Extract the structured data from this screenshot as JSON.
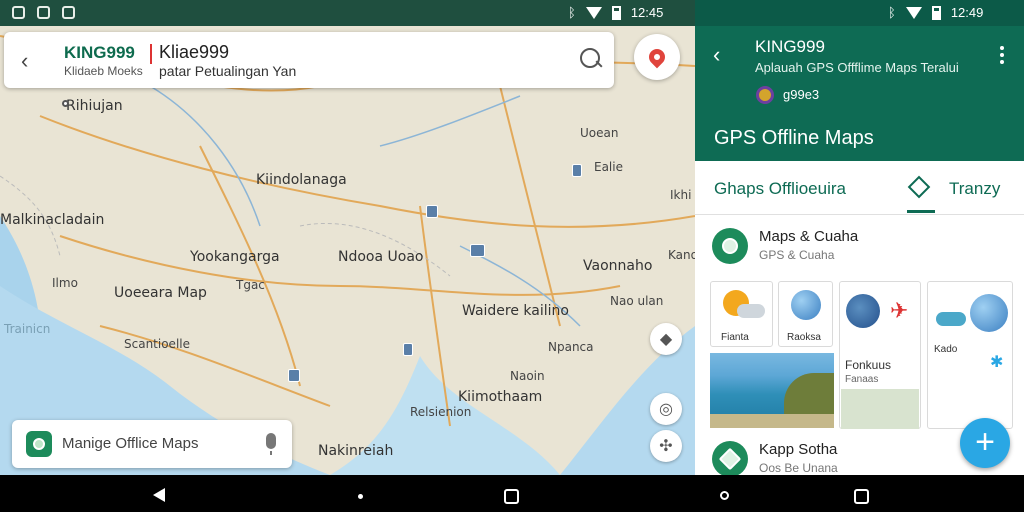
{
  "status_left": {
    "time": "12:45"
  },
  "status_right": {
    "time": "12:49"
  },
  "map": {
    "search_card": {
      "brand": "KING999",
      "brand_sub": "Kliae999",
      "tagline_left": "Klidaeb Moeks",
      "tagline_right": "patar Petualingan Yan"
    },
    "labels": {
      "rihiujan": "Rihiujan",
      "uoean": "Uoean",
      "ealie": "Ealie",
      "kiindolanaga": "Kiindolanaga",
      "malkinacladain": "Malkinacladain",
      "ikhi": "Ikhi",
      "yookangarga": "Yookangarga",
      "ndoa_uoao": "Ndooa Uoao",
      "vaonnaho": "Vaonnaho",
      "kano": "Kano",
      "ilmo": "Ilmo",
      "uoeeara_map": "Uoeeara Map",
      "tgac": "Tgac",
      "uailaera_kailino": "Waidere kailino",
      "nao_ulan": "Nao ulan",
      "trainicn": "Trainicn",
      "scantioelle": "Scantioelle",
      "npanca": "Npanca",
      "naoin": "Naoin",
      "kiimothaam": "Kiimothaam",
      "relsienion": "Relsienion",
      "nakinreiah": "Nakinreiah"
    },
    "bottom_search": {
      "placeholder": "Manige Offlice Maps"
    }
  },
  "panel": {
    "title": "KING999",
    "subtitle": "Aplauah GPS Offflime Maps Teralui",
    "rating": "g99e3",
    "heading": "GPS Offline Maps",
    "tabs": {
      "main": "Ghaps Offlioeuira",
      "second": "Tranzy"
    },
    "items": [
      {
        "title": "Maps & Cuaha",
        "sub": "GPS & Cuaha"
      },
      {
        "title": "Kapp Sotha",
        "sub": "Oos Be Unana"
      }
    ],
    "tiles": {
      "t1": "Fianta",
      "t2": "Raoksa",
      "t3": "Fonkuus",
      "t3_sub": "Fanaas",
      "t4": "Kado"
    }
  },
  "colors": {
    "brand_green": "#0e6b54",
    "fab_blue": "#2aa7e4",
    "pin_red": "#e0443c"
  }
}
